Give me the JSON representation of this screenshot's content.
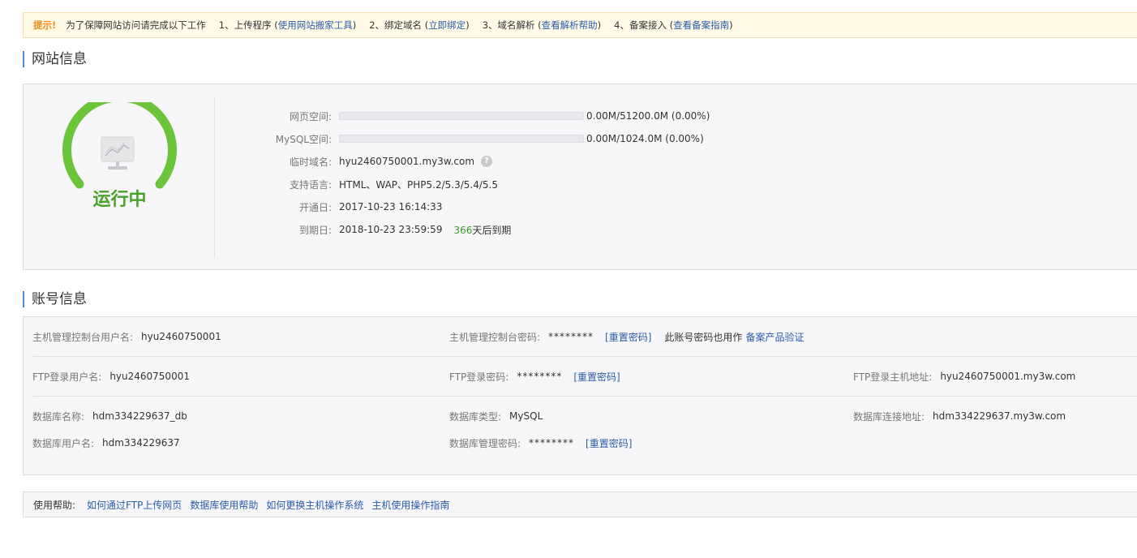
{
  "notice": {
    "tip": "提示!",
    "intro": "为了保障网站访问请完成以下工作",
    "steps": [
      {
        "prefix": "1、上传程序 (",
        "link": "使用网站搬家工具",
        "suffix": ")"
      },
      {
        "prefix": "2、绑定域名 (",
        "link": "立即绑定",
        "suffix": ")"
      },
      {
        "prefix": "3、域名解析 (",
        "link": "查看解析帮助",
        "suffix": ")"
      },
      {
        "prefix": "4、备案接入 (",
        "link": "查看备案指南",
        "suffix": ")"
      }
    ]
  },
  "site_info": {
    "title": "网站信息",
    "status": "运行中",
    "status_color": "#6bc43a",
    "rows": {
      "web_space": {
        "label": "网页空间:",
        "value": "0.00M/51200.0M (0.00%)",
        "used_fraction": 0.0
      },
      "mysql_space": {
        "label": "MySQL空间:",
        "value": "0.00M/1024.0M (0.00%)",
        "used_fraction": 0.0
      },
      "temp_domain": {
        "label": "临时域名:",
        "value": "hyu2460750001.my3w.com",
        "help_icon": "?"
      },
      "languages": {
        "label": "支持语言:",
        "value": "HTML、WAP、PHP5.2/5.3/5.4/5.5"
      },
      "open_date": {
        "label": "开通日:",
        "value": "2017-10-23 16:14:33"
      },
      "expire_date": {
        "label": "到期日:",
        "value": "2018-10-23 23:59:59",
        "days_num": "366",
        "days_suffix": "天后到期"
      }
    }
  },
  "account_info": {
    "title": "账号信息",
    "console_user": {
      "label": "主机管理控制台用户名:",
      "value": "hyu2460750001"
    },
    "console_pw": {
      "label": "主机管理控制台密码:",
      "value": "********",
      "reset": "[重置密码]",
      "note": "此账号密码也用作",
      "note_link": "备案产品验证"
    },
    "ftp_user": {
      "label": "FTP登录用户名:",
      "value": "hyu2460750001"
    },
    "ftp_pw": {
      "label": "FTP登录密码:",
      "value": "********",
      "reset": "[重置密码]"
    },
    "ftp_host": {
      "label": "FTP登录主机地址:",
      "value": "hyu2460750001.my3w.com"
    },
    "db_name": {
      "label": "数据库名称:",
      "value": "hdm334229637_db"
    },
    "db_type": {
      "label": "数据库类型:",
      "value": "MySQL"
    },
    "db_host": {
      "label": "数据库连接地址:",
      "value": "hdm334229637.my3w.com"
    },
    "db_user": {
      "label": "数据库用户名:",
      "value": "hdm334229637"
    },
    "db_pw": {
      "label": "数据库管理密码:",
      "value": "********",
      "reset": "[重置密码]"
    }
  },
  "help": {
    "label": "使用帮助:",
    "links": [
      "如何通过FTP上传网页",
      "数据库使用帮助",
      "如何更换主机操作系统",
      "主机使用操作指南"
    ]
  }
}
